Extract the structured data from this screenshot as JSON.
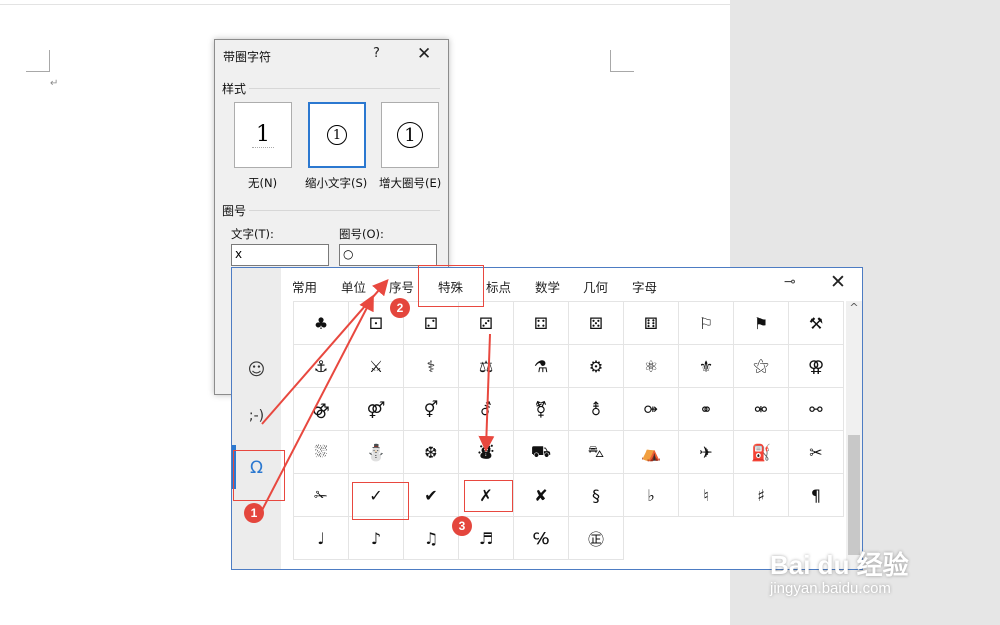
{
  "document": {
    "paragraph_mark": "↵"
  },
  "dialog": {
    "title": "带圈字符",
    "help": "?",
    "close": "✕",
    "style_section": "样式",
    "options": [
      {
        "label": "无(N)",
        "preview": "1"
      },
      {
        "label": "缩小文字(S)",
        "preview": "1"
      },
      {
        "label": "增大圈号(E)",
        "preview": "1"
      }
    ],
    "selected_option": "缩小文字(S)",
    "enclosure_section": "圈号",
    "text_label": "文字(T):",
    "text_value": "x",
    "circle_label": "圈号(O):",
    "circle_value": "○"
  },
  "panel": {
    "tabs": [
      "常用",
      "单位",
      "序号",
      "特殊",
      "标点",
      "数学",
      "几何",
      "字母"
    ],
    "pin": "⊸",
    "close": "✕",
    "side_buttons": [
      "☺",
      ";-)",
      "Ω"
    ],
    "symbols": [
      "♣",
      "⚀",
      "⚁",
      "⚂",
      "⚃",
      "⚄",
      "⚅",
      "⚐",
      "⚑",
      "⚒",
      "⚓",
      "⚔",
      "⚕",
      "⚖",
      "⚗",
      "⚙",
      "⚛",
      "⚜",
      "⚝",
      "⚢",
      "⚣",
      "⚤",
      "⚥",
      "⚦",
      "⚧",
      "⚨",
      "⚩",
      "⚭",
      "⚮",
      "⚯",
      "⛆",
      "⛄",
      "❆",
      "⛇",
      "⛟",
      "⛍",
      "⛺",
      "✈",
      "⛽",
      "✂",
      "✁",
      "✓",
      "✔",
      "✗",
      "✘",
      "§",
      "♭",
      "♮",
      "♯",
      "¶",
      "♩",
      "♪",
      "♫",
      "♬",
      "℅",
      "㊣"
    ],
    "scroll_up": "^"
  },
  "annotations": {
    "badge1": "1",
    "badge2": "2",
    "badge3": "3"
  },
  "watermark": {
    "brand": "Bai du 经验",
    "url": "jingyan.baidu.com"
  }
}
